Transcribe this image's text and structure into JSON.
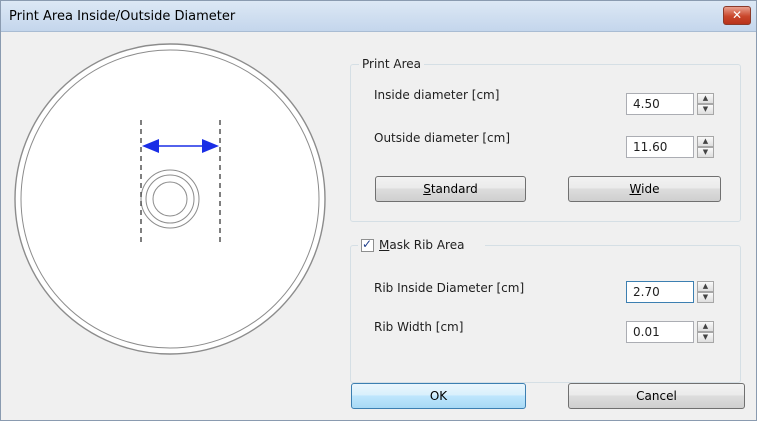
{
  "window": {
    "title": "Print Area Inside/Outside Diameter",
    "close_glyph": "✕"
  },
  "print_area": {
    "title": "Print Area",
    "inside_label": "Inside diameter [cm]",
    "inside_value": "4.50",
    "outside_label": "Outside diameter [cm]",
    "outside_value": "11.60",
    "standard_button": "Standard",
    "standard_mnemonic": "S",
    "wide_button": "Wide",
    "wide_mnemonic": "W"
  },
  "mask_rib": {
    "checkbox_label": "Mask Rib Area",
    "checkbox_mnemonic": "M",
    "checked": true,
    "rib_inside_label": "Rib Inside Diameter [cm]",
    "rib_inside_value": "2.70",
    "rib_width_label": "Rib Width [cm]",
    "rib_width_value": "0.01"
  },
  "buttons": {
    "ok": "OK",
    "cancel": "Cancel"
  },
  "icons": {
    "spin_up": "▲",
    "spin_down": "▼",
    "check": "✓"
  },
  "colors": {
    "arrow": "#1a2ee6",
    "disc_outline": "#8c8c8c"
  }
}
